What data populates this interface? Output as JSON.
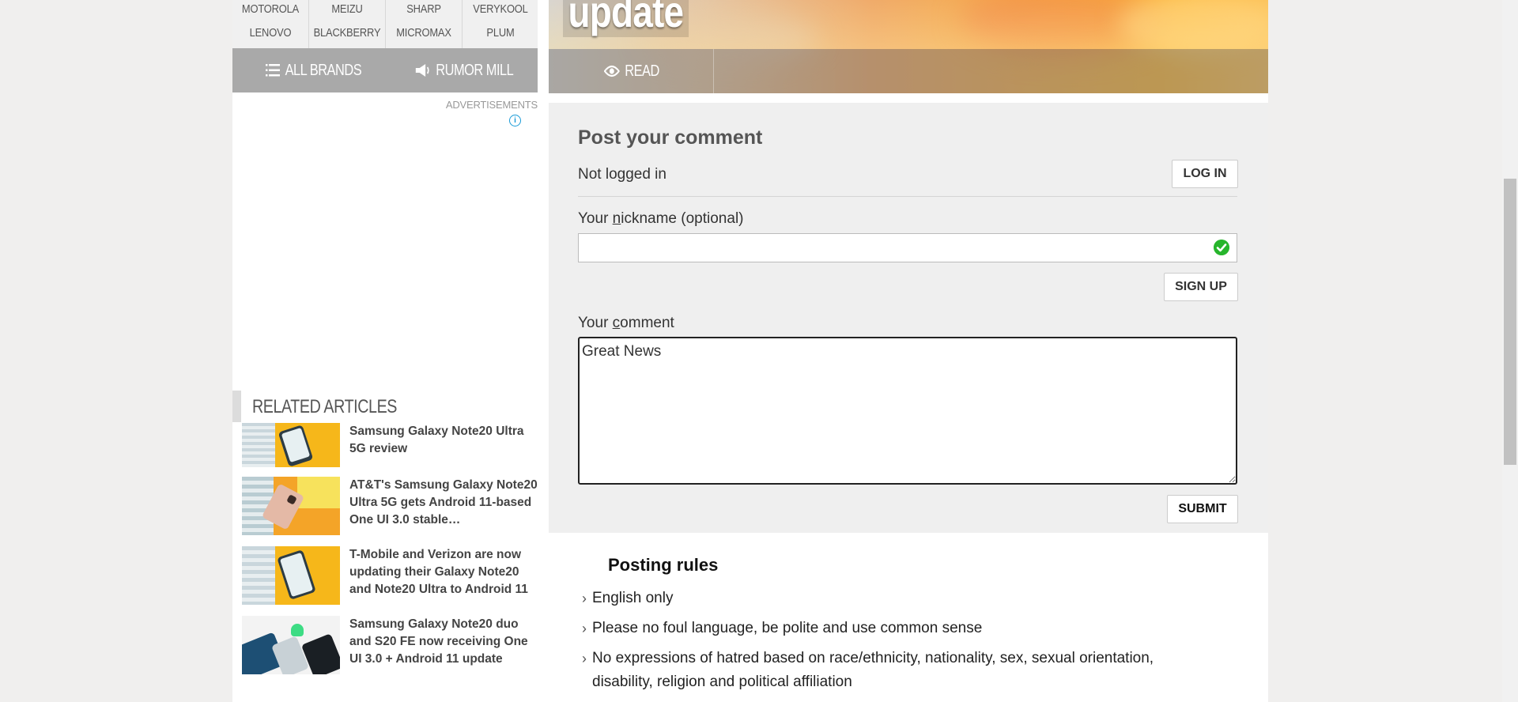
{
  "brands": {
    "row1": [
      "MOTOROLA",
      "MEIZU",
      "SHARP",
      "VERYKOOL"
    ],
    "row2": [
      "LENOVO",
      "BLACKBERRY",
      "MICROMAX",
      "PLUM"
    ],
    "all_brands_label": "ALL BRANDS",
    "rumor_mill_label": "RUMOR MILL"
  },
  "ads": {
    "label": "ADVERTISEMENTS",
    "info_glyph": "i"
  },
  "related": {
    "heading": "RELATED ARTICLES",
    "articles": [
      {
        "title": "Samsung Galaxy Note20 Ultra 5G review"
      },
      {
        "title": "AT&T's Samsung Galaxy Note20 Ultra 5G gets Android 11-based One UI 3.0 stable…"
      },
      {
        "title": "T-Mobile and Verizon are now updating their Galaxy Note20 and Note20 Ultra to Android 11"
      },
      {
        "title": "Samsung Galaxy Note20 duo and S20 FE now receiving One UI 3.0 + Android 11 update"
      }
    ]
  },
  "hero": {
    "title": "update",
    "read_label": "READ"
  },
  "comment_form": {
    "title": "Post your comment",
    "status": "Not logged in",
    "login_label": "LOG IN",
    "nickname_pre": "Your ",
    "nickname_u": "n",
    "nickname_post": "ickname (optional)",
    "nickname_value": "",
    "signup_label": "SIGN UP",
    "comment_pre": "Your ",
    "comment_u": "c",
    "comment_post": "omment",
    "comment_value": "Great News",
    "submit_label": "SUBMIT"
  },
  "posting_rules": {
    "title": "Posting rules",
    "items": [
      "English only",
      "Please no foul language, be polite and use common sense",
      "No expressions of hatred based on race/ethnicity, nationality, sex, sexual orientation, disability, religion and political affiliation"
    ]
  },
  "colors": {
    "accent_green": "#27b52c",
    "bar_gray": "#a9a9a9",
    "info_blue": "#1a9bd7"
  }
}
